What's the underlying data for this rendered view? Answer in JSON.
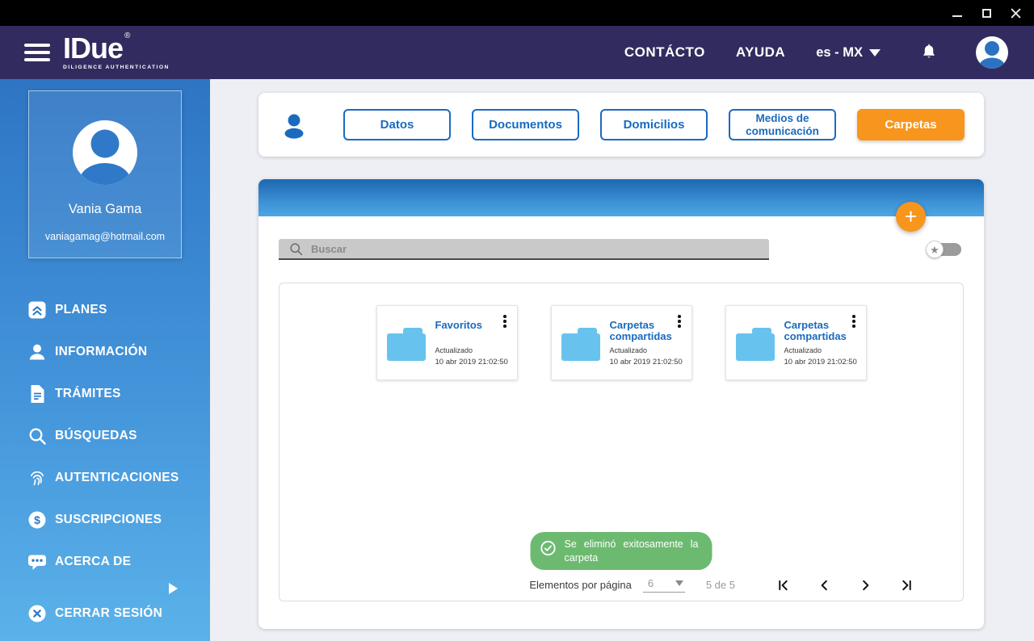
{
  "window": {
    "controls": {
      "minimize": "minimize",
      "maximize": "maximize",
      "close": "close"
    }
  },
  "header": {
    "logo": {
      "title": "IDue",
      "registered": "®",
      "subtitle": "DILIGENCE AUTHENTICATION"
    },
    "nav": {
      "contact": "CONTÁCTO",
      "help": "AYUDA"
    },
    "language": "es - MX"
  },
  "sidebar": {
    "profile": {
      "name": "Vania Gama",
      "email": "vaniagamag@hotmail.com"
    },
    "items": [
      {
        "label": "PLANES",
        "icon": "plans-icon"
      },
      {
        "label": "INFORMACIÓN",
        "icon": "person-icon"
      },
      {
        "label": "TRÁMITES",
        "icon": "document-icon"
      },
      {
        "label": "BÚSQUEDAS",
        "icon": "search-icon"
      },
      {
        "label": "AUTENTICACIONES",
        "icon": "fingerprint-icon"
      },
      {
        "label": "SUSCRIPCIONES",
        "icon": "dollar-circle-icon"
      },
      {
        "label": "ACERCA DE",
        "icon": "chat-icon"
      },
      {
        "label": "CERRAR SESIÓN",
        "icon": "close-circle-icon"
      }
    ]
  },
  "tabs": {
    "items": [
      {
        "label": "Datos",
        "active": false
      },
      {
        "label": "Documentos",
        "active": false
      },
      {
        "label": "Domicilios",
        "active": false
      },
      {
        "label": "Medios de comunicación",
        "active": false
      },
      {
        "label": "Carpetas",
        "active": true
      }
    ]
  },
  "folders": {
    "search_placeholder": "Buscar",
    "add_button": "+",
    "cards": [
      {
        "title": "Favoritos",
        "updated_label": "Actualizado",
        "updated_at": "10 abr 2019 21:02:50"
      },
      {
        "title": "Carpetas compartidas",
        "updated_label": "Actualizado",
        "updated_at": "10 abr 2019 21:02:50"
      },
      {
        "title": "Carpetas compartidas",
        "updated_label": "Actualizado",
        "updated_at": "10 abr 2019 21:02:50"
      }
    ],
    "toast": "Se eliminó exitosamente la carpeta",
    "pagination": {
      "items_per_page_label": "Elementos por página",
      "items_per_page": "6",
      "range": "5 de 5"
    }
  },
  "colors": {
    "header_navy": "#322b5f",
    "sidebar_gradient_top": "#2e75c4",
    "sidebar_gradient_bottom": "#5bb2e9",
    "accent_blue": "#1a6bbf",
    "accent_orange": "#f8951d",
    "folder_blue": "#67c3ee",
    "toast_green": "#6cba70",
    "main_background": "#edeff4"
  }
}
